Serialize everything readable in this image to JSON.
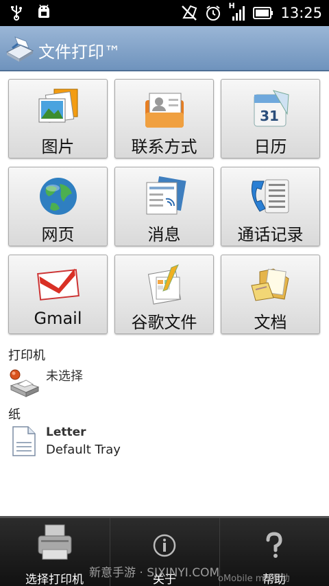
{
  "status_bar": {
    "time": "13:25",
    "icons": [
      "usb-icon",
      "android-debug-icon",
      "no-sync-icon",
      "alarm-icon",
      "signal-icon",
      "battery-icon"
    ],
    "network_label": "H"
  },
  "header": {
    "title": "文件打印™",
    "bg_color": "#7fa0c7"
  },
  "grid": {
    "tiles": [
      {
        "label": "图片",
        "icon": "photos-icon"
      },
      {
        "label": "联系方式",
        "icon": "contacts-icon"
      },
      {
        "label": "日历",
        "icon": "calendar-icon",
        "icon_text": "31"
      },
      {
        "label": "网页",
        "icon": "globe-icon"
      },
      {
        "label": "消息",
        "icon": "messages-icon"
      },
      {
        "label": "通话记录",
        "icon": "call-log-icon"
      },
      {
        "label": "Gmail",
        "icon": "gmail-icon"
      },
      {
        "label": "谷歌文件",
        "icon": "google-docs-icon"
      },
      {
        "label": "文档",
        "icon": "documents-folder-icon"
      }
    ]
  },
  "printer_section": {
    "heading": "打印机",
    "status": "未选择",
    "icon": "printer-icon"
  },
  "paper_section": {
    "heading": "纸",
    "size": "Letter",
    "tray": "Default Tray",
    "icon": "paper-icon"
  },
  "bottom_bar": {
    "items": [
      {
        "label": "选择打印机",
        "icon": "printer-icon"
      },
      {
        "label": "关于",
        "icon": "info-icon"
      },
      {
        "label": "帮助",
        "icon": "help-icon"
      }
    ]
  },
  "watermark": {
    "text": "新意手游 · SJXINYI.COM",
    "small_text": "oMobile mix帮助"
  }
}
